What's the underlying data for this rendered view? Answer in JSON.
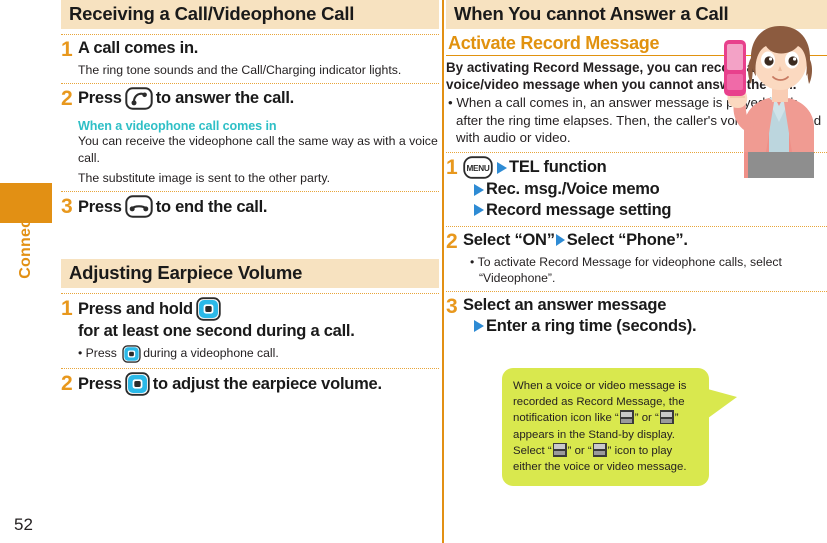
{
  "sidebar": {
    "tab_label": "Connect",
    "page_number": "52",
    "tab_color": "#e29014"
  },
  "left_column": {
    "sections": [
      {
        "header": "Receiving a Call/Videophone Call",
        "steps": [
          {
            "num": "1",
            "title_before": "A call comes in.",
            "icon": null,
            "title_after": "",
            "body": "The ring tone sounds and the Call/Charging indicator lights."
          },
          {
            "num": "2",
            "title_before": "Press",
            "icon": "answer-call-key-icon",
            "title_after": "to answer the call.",
            "teal_heading": "When a videophone call comes in",
            "paragraphs": [
              "You can receive the videophone call the same way as with a voice call.",
              "The substitute image is sent to the other party."
            ]
          },
          {
            "num": "3",
            "title_before": "Press",
            "icon": "end-call-key-icon",
            "title_after": "to end the call."
          }
        ]
      },
      {
        "header": "Adjusting Earpiece Volume",
        "steps": [
          {
            "num": "1",
            "title_before": "Press and hold",
            "icon": "nav-up-key-icon",
            "title_after": "for at least one second during a call.",
            "bullet_before": "Press",
            "bullet_icon": "nav-down-key-icon",
            "bullet_after": "during a videophone call."
          },
          {
            "num": "2",
            "title_before": "Press",
            "icon": "nav-key-icon",
            "title_after": "to adjust the earpiece volume."
          }
        ]
      }
    ]
  },
  "right_column": {
    "header": "When You cannot Answer a Call",
    "sub_heading": "Activate Record Message",
    "intro": "By activating Record Message, you can record a caller's voice/video message when you cannot answer the call.",
    "intro_bullet": "When a call comes in, an answer message is played back after the ring time elapses. Then, the caller's voice is recorded with audio or video.",
    "steps": [
      {
        "num": "1",
        "icon": "menu-key-icon",
        "line1": "TEL function",
        "line2": "Rec. msg./Voice memo",
        "line3": "Record message setting"
      },
      {
        "num": "2",
        "part1": "Select “ON”",
        "part2": "Select “Phone”.",
        "bullet": "To activate Record Message for videophone calls, select “Videophone”."
      },
      {
        "num": "3",
        "line1": "Select an answer message",
        "line2": "Enter a ring time (seconds)."
      }
    ],
    "speech_bubble": {
      "part1": "When a voice or video message is recorded as Record Message, the notification icon like “",
      "part2": "” or “",
      "part3": "” appears in the Stand-by display. Select “",
      "part4": "” or “",
      "part5": "” icon to play either the voice or video message.",
      "bg_color": "#d9e84e"
    }
  },
  "colors": {
    "header_bg": "#f7e2c0",
    "accent_orange": "#e1920f",
    "teal": "#2fbfc6",
    "arrow_blue": "#2e8bd4",
    "nav_key_cyan": "#2bb9e8"
  }
}
